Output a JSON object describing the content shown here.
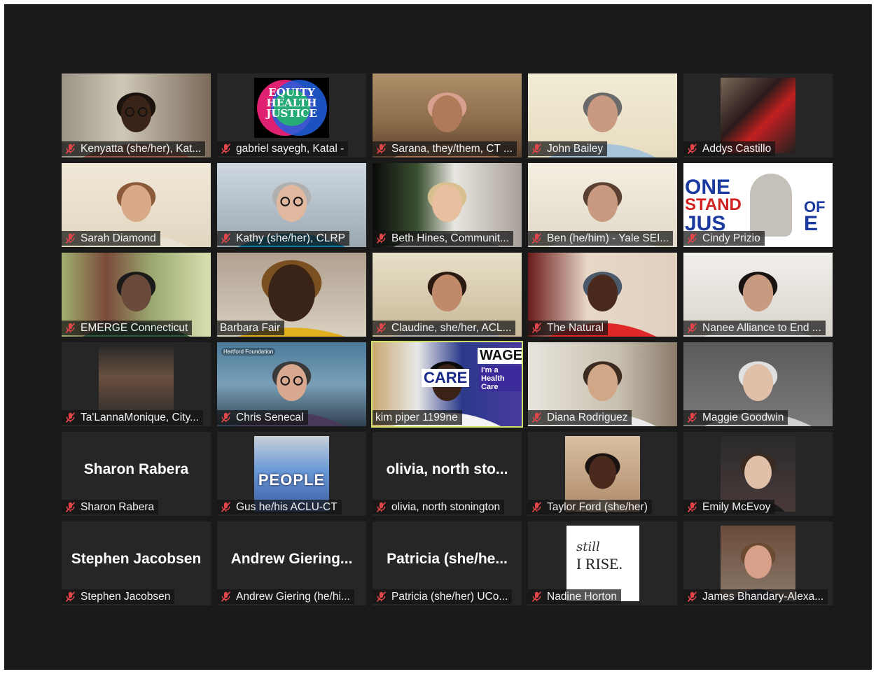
{
  "participants": [
    {
      "name": "Kenyatta (she/her), Kat...",
      "muted": true
    },
    {
      "name": "gabriel sayegh, Katal -",
      "muted": true,
      "avatar_text": [
        "EQUITY",
        "HEALTH",
        "JUSTICE"
      ]
    },
    {
      "name": "Sarana, they/them, CT ...",
      "muted": true
    },
    {
      "name": "John Bailey",
      "muted": true
    },
    {
      "name": "Addys Castillo",
      "muted": true
    },
    {
      "name": "Sarah Diamond",
      "muted": true
    },
    {
      "name": "Kathy (she/her), CLRP",
      "muted": true
    },
    {
      "name": "Beth Hines, Communit...",
      "muted": true
    },
    {
      "name": "Ben (he/him) - Yale SEI...",
      "muted": true
    },
    {
      "name": "Cindy Prizio",
      "muted": true,
      "avatar_text": [
        "ONE",
        "STAND",
        "OF",
        "JUS",
        "E"
      ]
    },
    {
      "name": "EMERGE Connecticut",
      "muted": true
    },
    {
      "name": "Barbara Fair",
      "muted": false
    },
    {
      "name": "Claudine, she/her, ACL...",
      "muted": true
    },
    {
      "name": "The Natural",
      "muted": true
    },
    {
      "name": "Nanee Alliance to End ...",
      "muted": true
    },
    {
      "name": "Ta'LannaMonique, City...",
      "muted": true
    },
    {
      "name": "Chris Senecal",
      "muted": true,
      "avatar_text": [
        "Hartford Foundation"
      ]
    },
    {
      "name": "kim piper 1199ne",
      "muted": false,
      "active": true,
      "avatar_text": [
        "WAGE",
        "CARE",
        "I'm a Health Care"
      ]
    },
    {
      "name": "Diana Rodriguez",
      "muted": true
    },
    {
      "name": "Maggie Goodwin",
      "muted": true
    },
    {
      "name": "Sharon Rabera",
      "muted": true,
      "display_name": "Sharon Rabera"
    },
    {
      "name": "Gus he/his ACLU-CT",
      "muted": true,
      "avatar_text": [
        "PEOPLE"
      ]
    },
    {
      "name": "olivia, north stonington",
      "muted": true,
      "display_name": "olivia, north sto..."
    },
    {
      "name": "Taylor Ford (she/her)",
      "muted": true
    },
    {
      "name": "Emily McEvoy",
      "muted": true
    },
    {
      "name": "Stephen Jacobsen",
      "muted": true,
      "display_name": "Stephen Jacobsen"
    },
    {
      "name": "Andrew Giering (he/hi...",
      "muted": true,
      "display_name": "Andrew  Giering..."
    },
    {
      "name": "Patricia (she/her) UCo...",
      "muted": true,
      "display_name": "Patricia  (she/he..."
    },
    {
      "name": "Nadine Horton",
      "muted": true,
      "avatar_text": [
        "still",
        "I RISE."
      ]
    },
    {
      "name": "James Bhandary-Alexa...",
      "muted": true
    }
  ],
  "colors": {
    "background": "#1a1a1a",
    "tile": "#262626",
    "active_border": "#d4e06a",
    "muted_icon": "#e0464a"
  }
}
